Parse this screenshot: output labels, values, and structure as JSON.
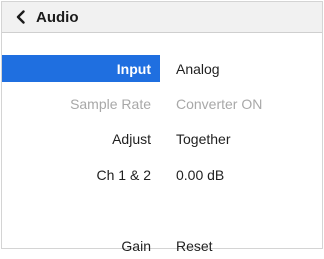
{
  "header": {
    "title": "Audio",
    "back_icon": "chevron-left-icon"
  },
  "rows": [
    {
      "label": "Input",
      "value": "Analog",
      "state": "selected"
    },
    {
      "label": "Sample Rate",
      "value": "Converter ON",
      "state": "disabled"
    },
    {
      "label": "Adjust",
      "value": "Together",
      "state": "normal"
    },
    {
      "label": "Ch 1 & 2",
      "value": "0.00 dB",
      "state": "normal"
    },
    {
      "label": "Gain",
      "value": "Reset",
      "state": "normal"
    }
  ],
  "colors": {
    "selection": "#1f6fe0",
    "disabled_text": "#a8a8a8"
  }
}
